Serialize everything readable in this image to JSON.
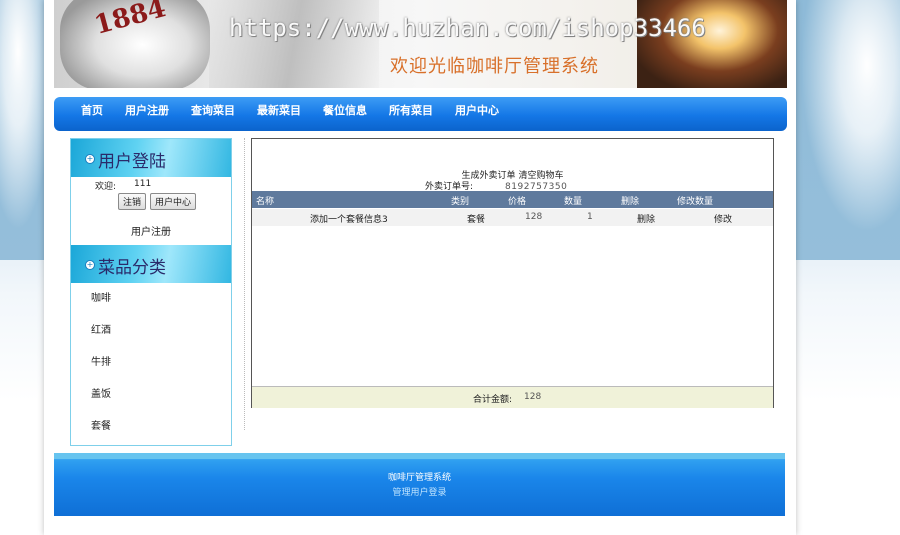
{
  "banner": {
    "brand": "1884",
    "watermark_url": "https://www.huzhan.com/ishop33466",
    "welcome": "欢迎光临咖啡厅管理系统"
  },
  "nav": {
    "items": [
      "首页",
      "用户注册",
      "查询菜目",
      "最新菜目",
      "餐位信息",
      "所有菜目",
      "用户中心"
    ]
  },
  "login": {
    "title": "用户登陆",
    "welcome_label": "欢迎:",
    "username": "111",
    "logout_button": "注销",
    "user_center_button": "用户中心",
    "register_link": "用户注册"
  },
  "categories": {
    "title": "菜品分类",
    "items": [
      "咖啡",
      "红酒",
      "牛排",
      "盖饭",
      "套餐"
    ]
  },
  "cart": {
    "generate_order": "生成外卖订单",
    "clear_cart": "清空购物车",
    "order_no_label": "外卖订单号:",
    "order_no": "8192757350",
    "columns": [
      "名称",
      "类别",
      "价格",
      "数量",
      "删除",
      "修改数量"
    ],
    "rows": [
      {
        "name": "添加一个套餐信息3",
        "category": "套餐",
        "price": "128",
        "qty": "1",
        "delete": "删除",
        "modify": "修改"
      }
    ],
    "total_label": "合计金额:",
    "total_value": "128"
  },
  "footer": {
    "system_name": "咖啡厅管理系统",
    "admin_login": "管理用户登录"
  },
  "colors": {
    "nav_blue": "#1477e6",
    "table_header": "#5f7a9d",
    "total_bg": "#f0f2d9",
    "welcome_orange": "#d8702a"
  }
}
